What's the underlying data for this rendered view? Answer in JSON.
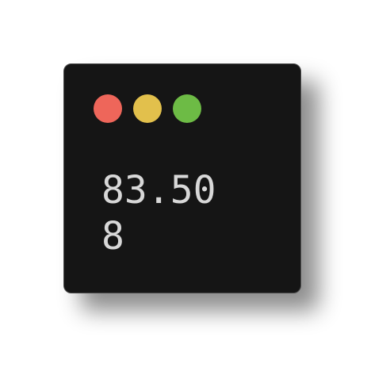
{
  "window": {
    "controls": [
      {
        "name": "close",
        "color": "#ee665a"
      },
      {
        "name": "minimize",
        "color": "#e2c04c"
      },
      {
        "name": "maximize",
        "color": "#6dbb45"
      }
    ],
    "content_lines": [
      "83.50",
      "8"
    ]
  }
}
